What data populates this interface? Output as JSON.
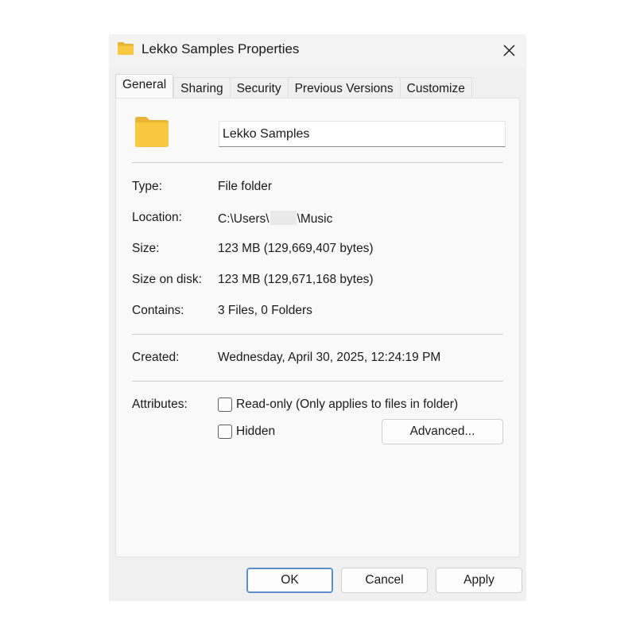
{
  "window": {
    "title": "Lekko Samples Properties",
    "folder_color": "#F8C93E",
    "accent_color": "#5A8FC8"
  },
  "tabs": [
    {
      "label": "General",
      "active": true
    },
    {
      "label": "Sharing",
      "active": false
    },
    {
      "label": "Security",
      "active": false
    },
    {
      "label": "Previous Versions",
      "active": false
    },
    {
      "label": "Customize",
      "active": false
    }
  ],
  "general": {
    "folder_name": "Lekko Samples",
    "type_label": "Type:",
    "type_value": "File folder",
    "location_label": "Location:",
    "location_prefix": "C:\\Users\\",
    "location_suffix": "\\Music",
    "size_label": "Size:",
    "size_value": "123 MB (129,669,407 bytes)",
    "size_on_disk_label": "Size on disk:",
    "size_on_disk_value": "123 MB (129,671,168 bytes)",
    "contains_label": "Contains:",
    "contains_value": "3 Files, 0 Folders",
    "created_label": "Created:",
    "created_value": "Wednesday, April 30, 2025, 12:24:19 PM",
    "attributes_label": "Attributes:",
    "readonly_label": "Read-only (Only applies to files in folder)",
    "readonly_checked": false,
    "hidden_label": "Hidden",
    "hidden_checked": false,
    "advanced_label": "Advanced..."
  },
  "footer": {
    "ok_label": "OK",
    "cancel_label": "Cancel",
    "apply_label": "Apply"
  },
  "icons": {
    "title": "folder-icon",
    "close": "close-icon",
    "big_folder": "folder-icon"
  }
}
